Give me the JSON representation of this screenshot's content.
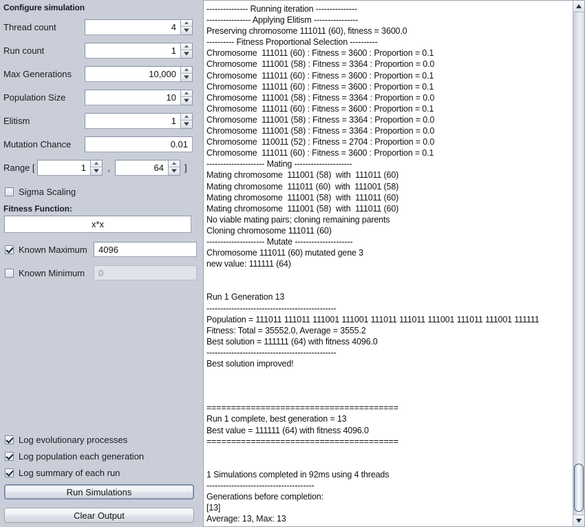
{
  "config": {
    "title": "Configure simulation",
    "fields": [
      {
        "label": "Thread count",
        "value": "4",
        "spinner": true,
        "enabled": true
      },
      {
        "label": "Run count",
        "value": "1",
        "spinner": true,
        "enabled": true
      },
      {
        "label": "Max Generations",
        "value": "10,000",
        "spinner": true,
        "enabled": true
      },
      {
        "label": "Population Size",
        "value": "10",
        "spinner": true,
        "enabled": true
      },
      {
        "label": "Elitism",
        "value": "1",
        "spinner": true,
        "enabled": true
      },
      {
        "label": "Mutation Chance",
        "value": "0.01",
        "spinner": false,
        "enabled": true
      }
    ],
    "range": {
      "label_open": "Range [",
      "min_value": "1",
      "separator": ",",
      "max_value": "64",
      "label_close": "]"
    },
    "sigma_scaling": {
      "label": "Sigma Scaling",
      "checked": false
    },
    "fitness_function": {
      "section_label": "Fitness Function:",
      "value": "x*x"
    },
    "known_maximum": {
      "label": "Known Maximum",
      "checked": true,
      "value": "4096",
      "enabled": true
    },
    "known_minimum": {
      "label": "Known Minimum",
      "checked": false,
      "value": "0",
      "enabled": false
    },
    "log_options": [
      {
        "label": "Log evolutionary processes",
        "checked": true
      },
      {
        "label": "Log population each generation",
        "checked": true
      },
      {
        "label": "Log summary of each run",
        "checked": true
      }
    ],
    "buttons": {
      "run": "Run Simulations",
      "clear": "Clear Output"
    }
  },
  "output": {
    "text": "--------------- Running iteration ---------------\n---------------- Applying Elitism ----------------\nPreserving chromosome 111011 (60), fitness = 3600.0\n---------- Fitness Proportional Selection ----------\nChromosome  111011 (60) : Fitness = 3600 : Proportion = 0.1\nChromosome  111001 (58) : Fitness = 3364 : Proportion = 0.0\nChromosome  111011 (60) : Fitness = 3600 : Proportion = 0.1\nChromosome  111011 (60) : Fitness = 3600 : Proportion = 0.1\nChromosome  111001 (58) : Fitness = 3364 : Proportion = 0.0\nChromosome  111011 (60) : Fitness = 3600 : Proportion = 0.1\nChromosome  111001 (58) : Fitness = 3364 : Proportion = 0.0\nChromosome  111001 (58) : Fitness = 3364 : Proportion = 0.0\nChromosome  110011 (52) : Fitness = 2704 : Proportion = 0.0\nChromosome  111011 (60) : Fitness = 3600 : Proportion = 0.1\n--------------------- Mating ---------------------\nMating chromosome  111001 (58)  with  111011 (60)\nMating chromosome  111011 (60)  with  111001 (58)\nMating chromosome  111001 (58)  with  111011 (60)\nMating chromosome  111001 (58)  with  111011 (60)\nNo viable mating pairs; cloning remaining parents\nCloning chromosome 111011 (60)\n--------------------- Mutate ---------------------\nChromosome 111011 (60) mutated gene 3\nnew value: 111111 (64)\n\n\nRun 1 Generation 13\n-----------------------------------------------\nPopulation = 111011 111011 111001 111001 111011 111011 111001 111011 111001 111111\nFitness: Total = 35552.0, Average = 3555.2\nBest solution = 111111 (64) with fitness 4096.0\n-----------------------------------------------\nBest solution improved!\n\n\n\n=======================================\nRun 1 complete, best generation = 13\nBest value = 111111 (64) with fitness 4096.0\n=======================================\n\n\n1 Simulations completed in 92ms using 4 threads\n---------------------------------------\nGenerations before completion:\n[13]\nAverage: 13, Max: 13"
  },
  "scrollbar": {
    "up_icon": "triangle-up-icon",
    "down_icon": "triangle-down-icon"
  },
  "colors": {
    "panel_bg": "#c9ced9",
    "log_bg": "#ffffff",
    "text": "#101010",
    "accent": "#6d7f9e"
  }
}
